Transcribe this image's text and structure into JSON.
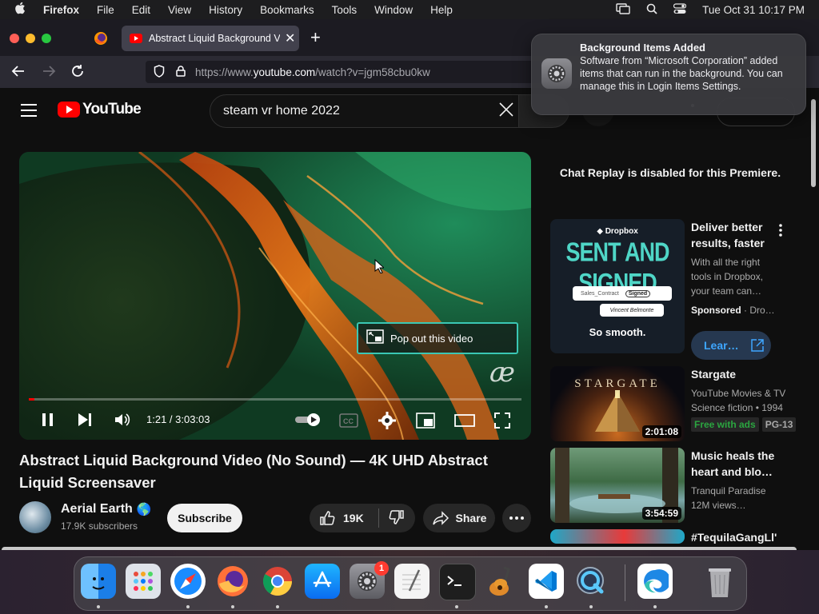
{
  "menubar": {
    "apple": "",
    "app_name": "Firefox",
    "items": [
      "File",
      "Edit",
      "View",
      "History",
      "Bookmarks",
      "Tools",
      "Window",
      "Help"
    ],
    "date_time": "Tue Oct 31  10:17 PM"
  },
  "browser": {
    "tab_title": "Abstract Liquid Background Vid",
    "new_tab": "+",
    "url_prefix": "https://www.",
    "url_domain": "youtube.com",
    "url_path": "/watch?v=jgm58cbu0kw"
  },
  "youtube": {
    "logo_text": "YouTube",
    "search_value": "steam vr home 2022",
    "video": {
      "time": "1:21 / 3:03:03",
      "progress_fraction": 0.011,
      "pop_out_label": "Pop out this video",
      "watermark": "æ"
    },
    "title": "Abstract Liquid Background Video (No Sound) — 4K UHD Abstract Liquid Screensaver",
    "channel": {
      "name": "Aerial Earth",
      "globe": "🌎",
      "subscribers": "17.9K subscribers",
      "subscribe": "Subscribe"
    },
    "actions": {
      "likes": "19K",
      "share": "Share"
    },
    "chat_replay": "Chat Replay is disabled for this Premiere.",
    "recs": [
      {
        "title": "Deliver better results, faster",
        "desc": "With all the right tools in Dropbox, your team can…",
        "sponsored": "Sponsored",
        "advertiser": "· Dro…",
        "learn": "Lear…",
        "thumb_brand": "Dropbox",
        "thumb_headline": "SENT AND SIGNED",
        "thumb_contract": "Sales_Contract",
        "thumb_signed": "Signed",
        "thumb_signer": "Vincent Belmonte",
        "thumb_tag": "So smooth."
      },
      {
        "title": "Stargate",
        "line1": "YouTube Movies & TV",
        "line2": "Science fiction • 1994",
        "badge_free": "Free with ads",
        "badge_rating": "PG-13",
        "duration": "2:01:08",
        "thumb_text": "STARGATE"
      },
      {
        "title": "Music heals the heart and blo…",
        "line1": "Tranquil Paradise",
        "line2": "12M views…",
        "duration": "3:54:59"
      },
      {
        "title": "#TequilaGangLl'"
      }
    ]
  },
  "notification": {
    "title": "Background Items Added",
    "body": "Software from “Microsoft Corporation” added items that can run in the background. You can manage this in Login Items Settings."
  },
  "dock": {
    "apps": [
      "Finder",
      "Launchpad",
      "Safari",
      "Firefox",
      "Chrome",
      "App Store",
      "System Settings",
      "TextEdit",
      "Terminal",
      "GarageBand",
      "Visual Studio Code",
      "QuickTime",
      "Edge",
      "Trash"
    ],
    "settings_badge": "1"
  },
  "colors": {
    "youtube_red": "#ff0000",
    "bg": "#0f0f0f",
    "learn_blue": "#3ea6ff",
    "free_green": "#2ba640"
  }
}
